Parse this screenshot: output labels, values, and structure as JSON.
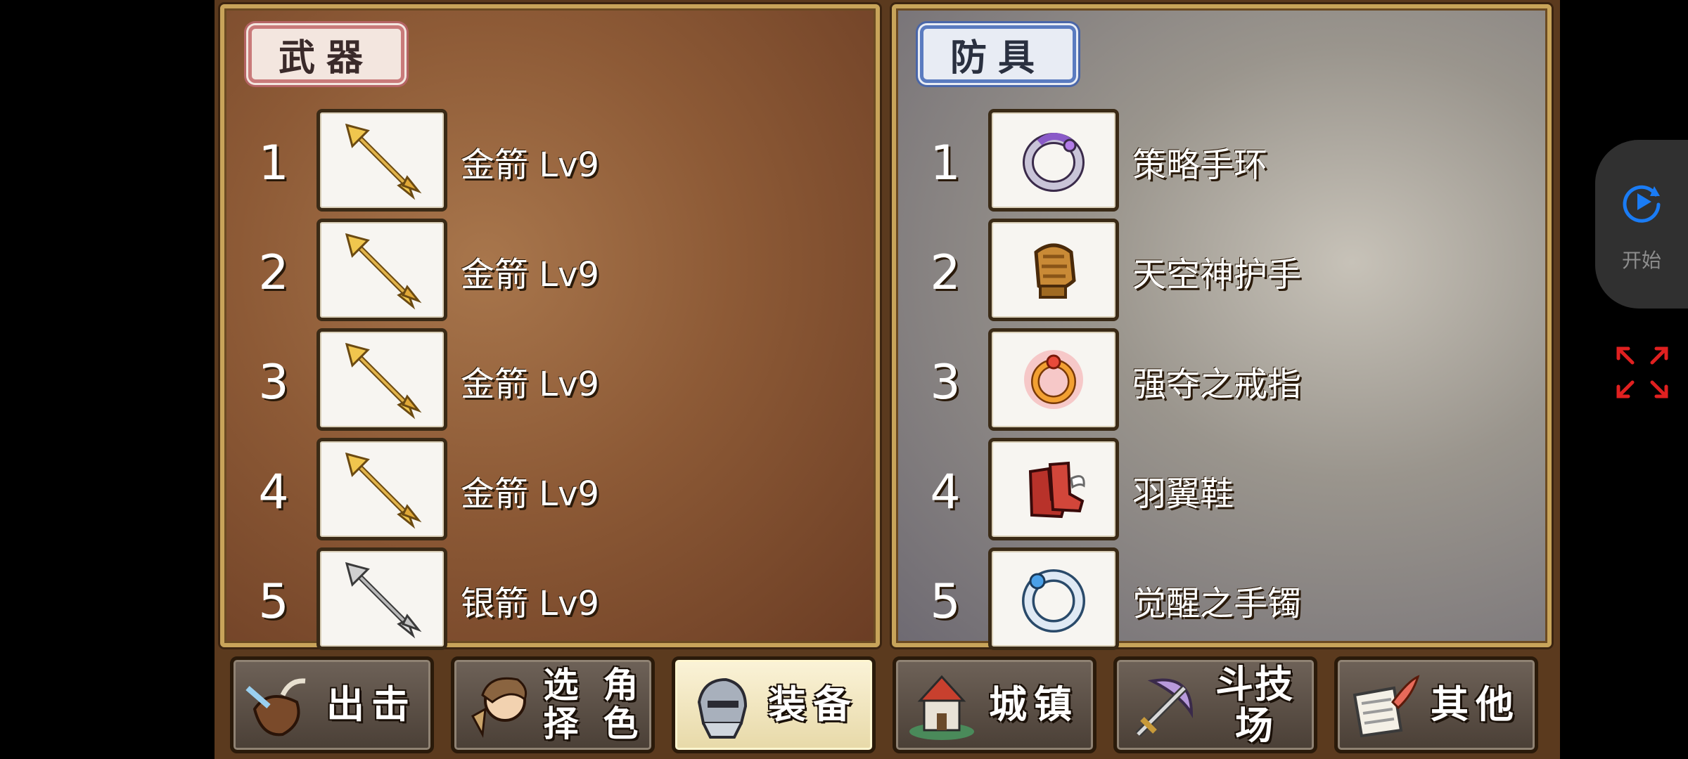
{
  "weapons": {
    "title": "武器",
    "items": [
      {
        "num": "1",
        "name": "金箭 Lv9",
        "icon": "golden-arrow-icon"
      },
      {
        "num": "2",
        "name": "金箭 Lv9",
        "icon": "golden-arrow-icon"
      },
      {
        "num": "3",
        "name": "金箭 Lv9",
        "icon": "golden-arrow-icon"
      },
      {
        "num": "4",
        "name": "金箭 Lv9",
        "icon": "golden-arrow-icon"
      },
      {
        "num": "5",
        "name": "银箭 Lv9",
        "icon": "silver-arrow-icon"
      }
    ]
  },
  "armor": {
    "title": "防具",
    "items": [
      {
        "num": "1",
        "name": "策略手环",
        "icon": "strategy-bracelet-icon"
      },
      {
        "num": "2",
        "name": "天空神护手",
        "icon": "sky-god-gauntlet-icon"
      },
      {
        "num": "3",
        "name": "强夺之戒指",
        "icon": "plunder-ring-icon"
      },
      {
        "num": "4",
        "name": "羽翼鞋",
        "icon": "winged-boots-icon"
      },
      {
        "num": "5",
        "name": "觉醒之手镯",
        "icon": "awakening-bangle-icon"
      }
    ]
  },
  "nav": {
    "sortie": "出击",
    "select_char_line1": "选择",
    "select_char_line2": "角色",
    "equipment": "装备",
    "town": "城镇",
    "arena": "斗技场",
    "other": "其他",
    "active": "equipment"
  },
  "overlay": {
    "start_label": "开始",
    "accent": "#1a7cf5",
    "fullscreen_color": "#e02020"
  }
}
